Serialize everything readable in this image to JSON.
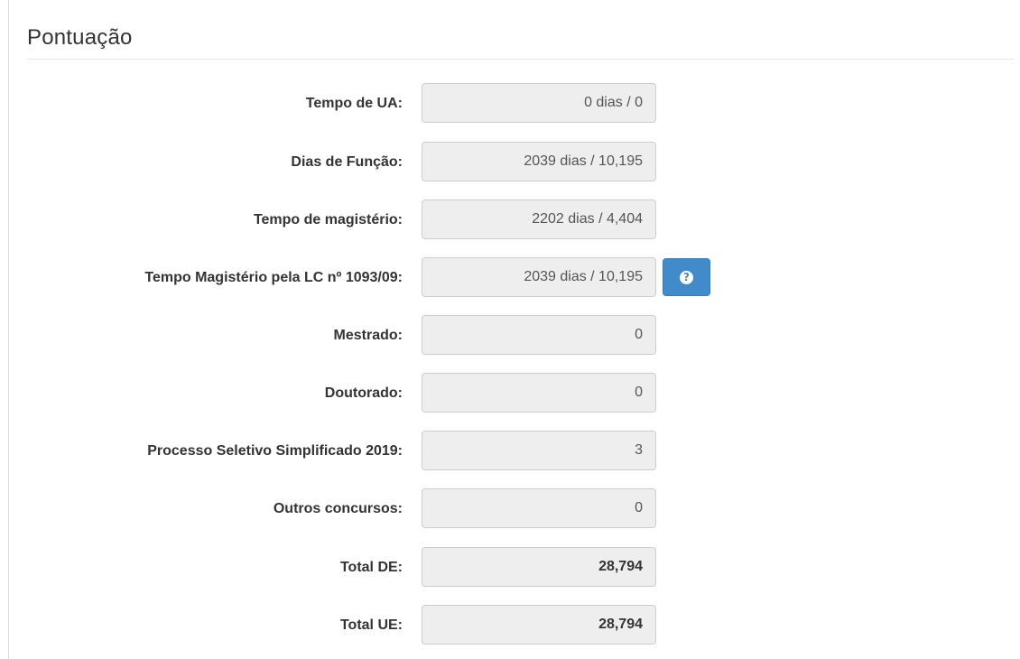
{
  "section": {
    "title": "Pontuação"
  },
  "rows": [
    {
      "label": "Tempo de UA:",
      "value": "0 dias / 0"
    },
    {
      "label": "Dias de Função:",
      "value": "2039 dias / 10,195"
    },
    {
      "label": "Tempo de magistério:",
      "value": "2202 dias / 4,404"
    },
    {
      "label": "Tempo Magistério pela LC nº 1093/09:",
      "value": "2039 dias / 10,195"
    },
    {
      "label": "Mestrado:",
      "value": "0"
    },
    {
      "label": "Doutorado:",
      "value": "0"
    },
    {
      "label": "Processo Seletivo Simplificado 2019:",
      "value": "3"
    },
    {
      "label": "Outros concursos:",
      "value": "0"
    },
    {
      "label": "Total DE:",
      "value": "28,794"
    },
    {
      "label": "Total UE:",
      "value": "28,794"
    }
  ],
  "help_button": {
    "icon": "question-circle-icon",
    "glyph": "?",
    "color": "#428bca"
  }
}
